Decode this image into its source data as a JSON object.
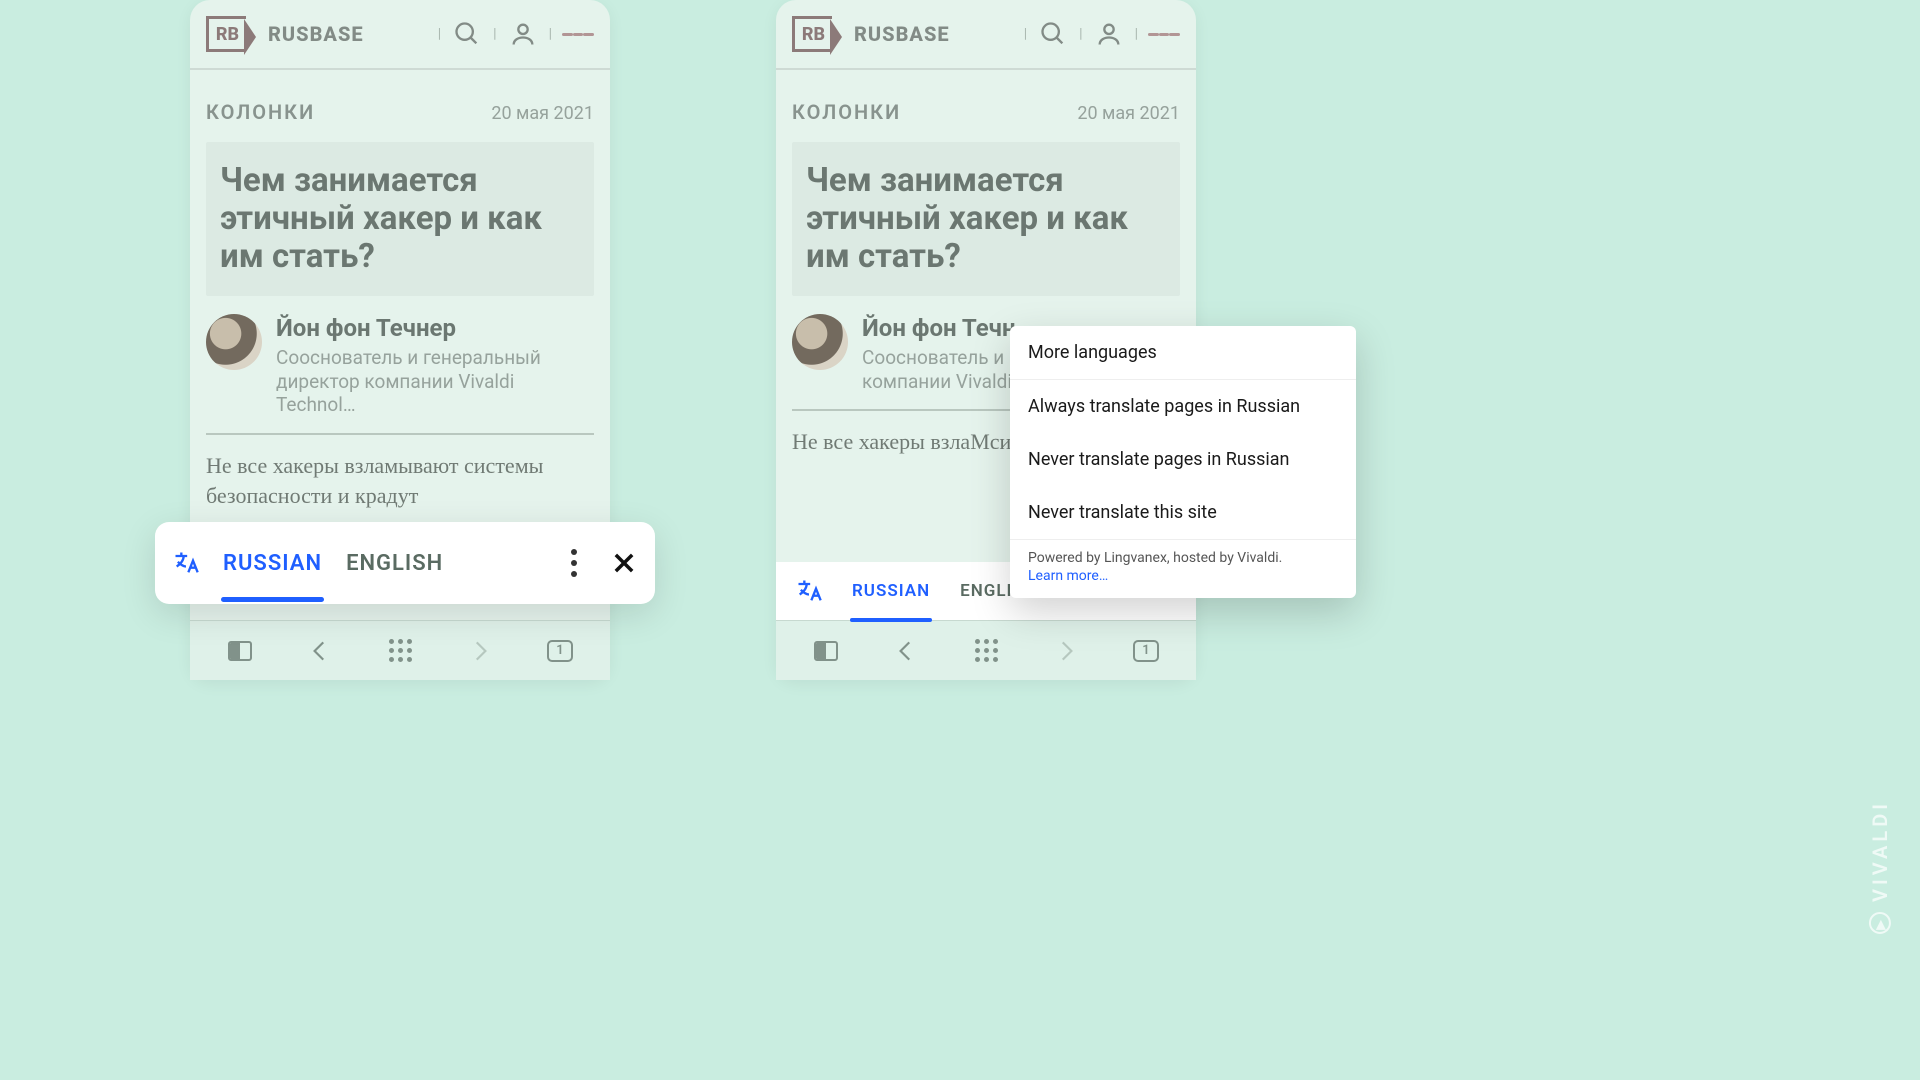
{
  "site": {
    "logo_short": "RB",
    "logo_text": "RUSBASE"
  },
  "article": {
    "category": "КОЛОНКИ",
    "date": "20 мая 2021",
    "title": "Чем занимается этичный хакер и как им стать?",
    "author_name": "Йон фон Течнер",
    "author_title_full": "Сооснователь и генеральный директор компании Vivaldi Technol…",
    "author_title_cut": "Сооснователь и генеральный ди компании Vivaldi",
    "author_name_cut": "Йон фон Течн",
    "body1": "Не все хакеры взламывают системы безопасности и крадут",
    "body1_cut": "Не все хакеры взлаМсистемы безопаснос"
  },
  "translate": {
    "lang1": "RUSSIAN",
    "lang2": "ENGLISH"
  },
  "menu": {
    "more_languages": "More languages",
    "always": "Always translate pages in Russian",
    "never_lang": "Never translate pages in Russian",
    "never_site": "Never translate this site",
    "powered": "Powered by Lingvanex, hosted by Vivaldi.",
    "learn": "Learn more…"
  },
  "nav": {
    "tab_count": "1"
  },
  "watermark": "VIVALDI"
}
